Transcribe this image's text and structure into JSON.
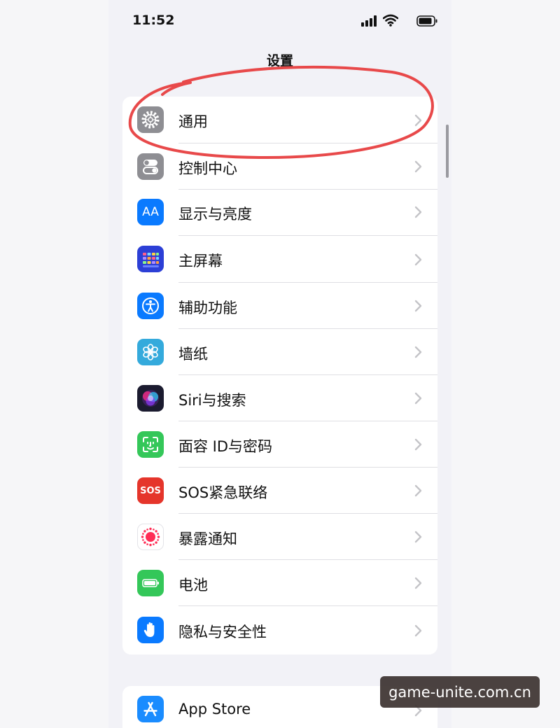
{
  "status_bar": {
    "time": "11:52",
    "icons": [
      "signal-icon",
      "wifi-icon",
      "battery-icon"
    ]
  },
  "header": {
    "title": "设置"
  },
  "settings_group": {
    "items": [
      {
        "label": "通用",
        "icon": "gear-icon",
        "color": "#8e8e93"
      },
      {
        "label": "控制中心",
        "icon": "toggles-icon",
        "color": "#8e8e93"
      },
      {
        "label": "显示与亮度",
        "icon": "text-size-icon",
        "color": "#0a7aff",
        "icon_text": "AA"
      },
      {
        "label": "主屏幕",
        "icon": "home-grid-icon",
        "color": "#2c3fd6"
      },
      {
        "label": "辅助功能",
        "icon": "accessibility-icon",
        "color": "#0a7aff"
      },
      {
        "label": "墙纸",
        "icon": "flower-icon",
        "color": "#34aadc"
      },
      {
        "label": "Siri与搜索",
        "icon": "siri-icon",
        "color": "#1b1b2f"
      },
      {
        "label": "面容 ID与密码",
        "icon": "face-id-icon",
        "color": "#34c759"
      },
      {
        "label": "SOS紧急联络",
        "icon": "sos-icon",
        "color": "#e5352b",
        "icon_text": "SOS"
      },
      {
        "label": "暴露通知",
        "icon": "exposure-icon",
        "color": "#ffffff"
      },
      {
        "label": "电池",
        "icon": "battery-icon",
        "color": "#34c759"
      },
      {
        "label": "隐私与安全性",
        "icon": "hand-icon",
        "color": "#0a7aff"
      }
    ]
  },
  "apps_group": {
    "items": [
      {
        "label": "App Store",
        "icon": "app-store-icon",
        "color": "#1a8cff"
      }
    ]
  },
  "annotation": {
    "color": "#e8494a"
  },
  "watermark": {
    "text": "game-unite.com.cn"
  }
}
